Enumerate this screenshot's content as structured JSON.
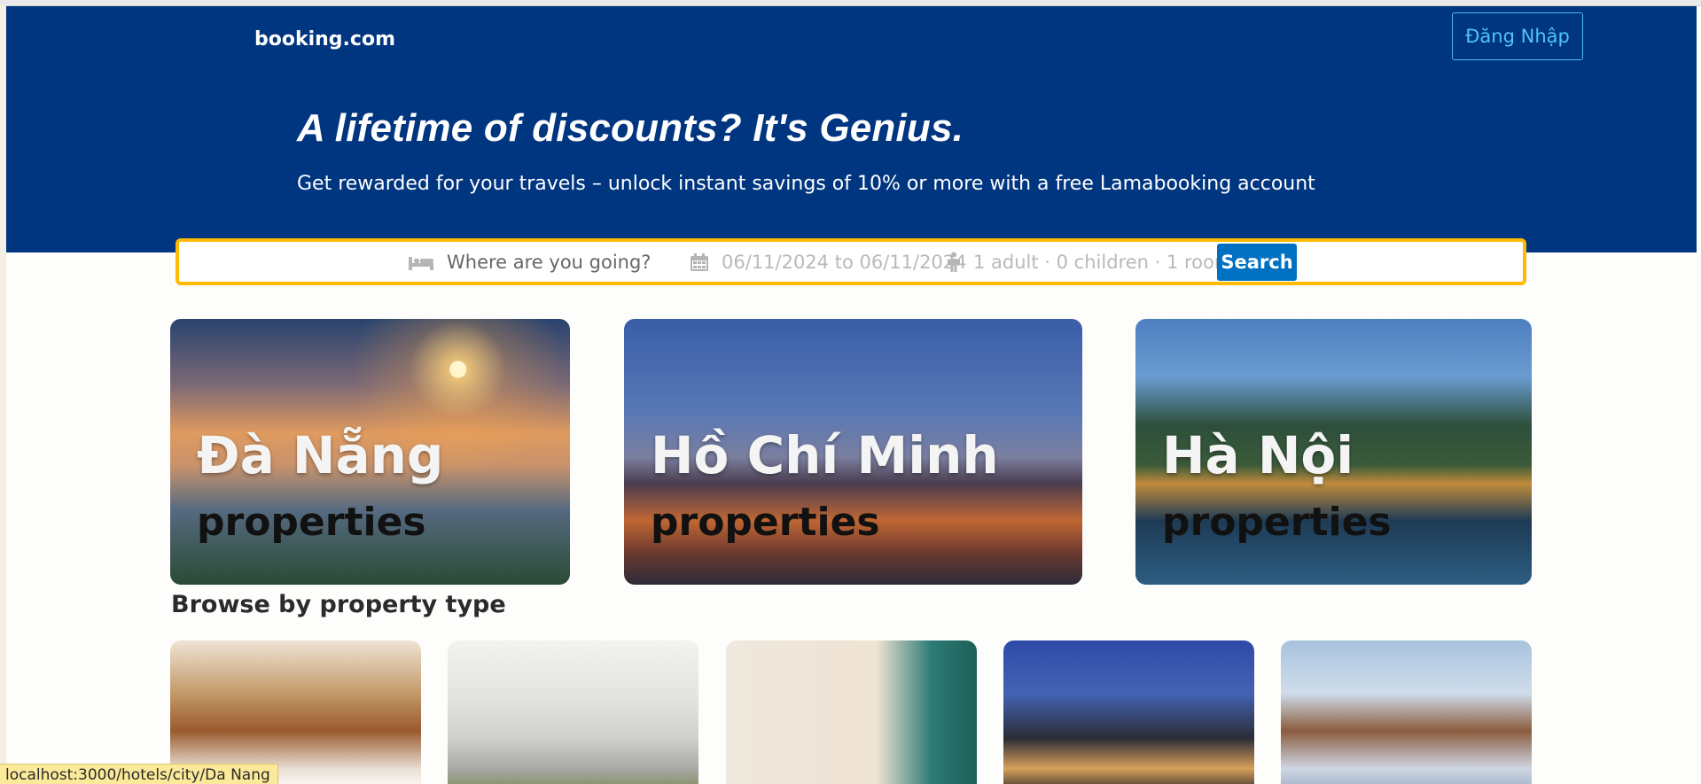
{
  "header": {
    "logo": "booking.com",
    "login_label": "Đăng Nhập",
    "hero_title": "A lifetime of discounts? It's Genius.",
    "hero_subtitle": "Get rewarded for your travels – unlock instant savings of 10% or more with a free Lamabooking account"
  },
  "search": {
    "destination_placeholder": "Where are you going?",
    "dates": "06/11/2024 to 06/11/2024",
    "occupancy": "1 adult · 0 children · 1 room",
    "button_label": "Search",
    "icons": [
      "bed-icon",
      "calendar-icon",
      "person-icon"
    ]
  },
  "cities": [
    {
      "name": "Đà Nẵng",
      "subtitle": "properties"
    },
    {
      "name": "Hồ Chí Minh",
      "subtitle": "properties"
    },
    {
      "name": "Hà Nội",
      "subtitle": "properties"
    }
  ],
  "property_section": {
    "title": "Browse by property type"
  },
  "status_bar": {
    "url": "localhost:3000/hotels/city/Da Nang"
  },
  "colors": {
    "header_bg": "#003580",
    "search_border": "#febb02",
    "search_button": "#0071c2",
    "login_text": "#4fc3f7"
  }
}
